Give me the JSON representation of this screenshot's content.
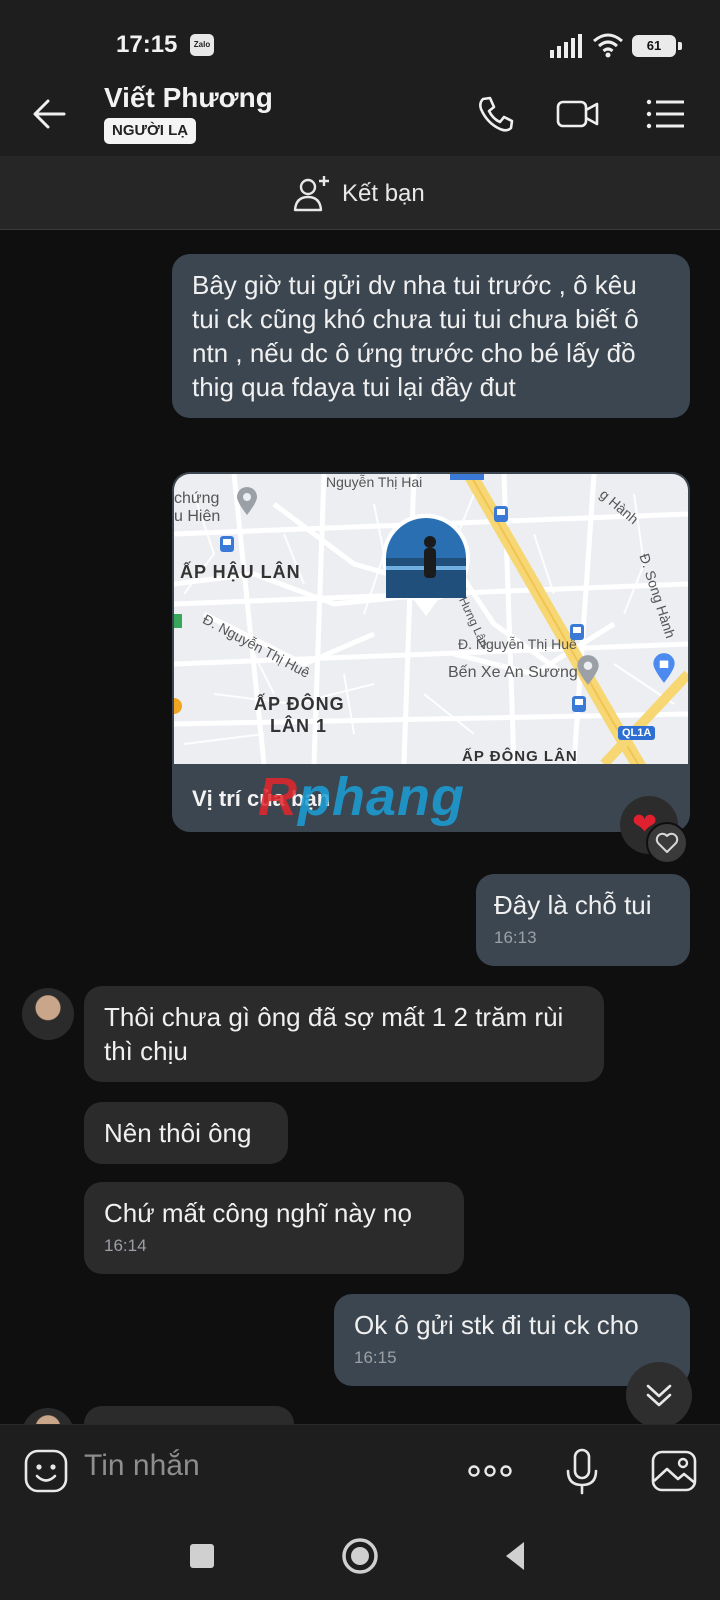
{
  "status": {
    "time": "17:15",
    "app_badge": "Zalo",
    "battery": "61"
  },
  "header": {
    "name": "Viết Phương",
    "tag": "NGƯỜI LẠ"
  },
  "add_friend": {
    "label": "Kết bạn"
  },
  "messages": {
    "m1": {
      "text": "Bây giờ tui gửi dv nha tui trước , ô kêu tui ck cũng khó chưa tui tui chưa biết ô ntn , nếu dc ô ứng trước cho bé lấy đồ thig qua fdaya tui lại đầy đut"
    },
    "location": {
      "caption": "Vị trí của bạn",
      "labels": {
        "nguyen_thi_hai": "Nguyễn Thị Hai",
        "chung_hien_1": "chứng",
        "chung_hien_2": "u Hiên",
        "ap_hau_lan": "ẤP HẬU LÂN",
        "nguyen_thi_hue": "Đ. Nguyễn Thị Huê",
        "nguyen_thi_hue2": "Đ. Nguyễn Thị Huê",
        "dong_lan": "Đông Lân - Hưng Lân",
        "song_hanh": "Đ. Song Hành",
        "hanh": "g Hành",
        "ben_xe": "Bến Xe An Sương",
        "ap_dong_lan": "ẤP ĐÔNG",
        "lan_1": "LÂN 1",
        "ap_dong_lan_bottom": "ẤP ĐÔNG LÂN",
        "ql1a": "QL1A"
      }
    },
    "watermark": {
      "part1": "R",
      "part2": "phang"
    },
    "m2": {
      "text": "Đây là chỗ tui",
      "time": "16:13"
    },
    "m3": {
      "text": "Thôi chưa gì ông đã sợ mất 1 2 trăm rùi thì chịu"
    },
    "m4": {
      "text": "Nên thôi ông"
    },
    "m5": {
      "text": "Chứ mất công nghĩ này nọ",
      "time": "16:14"
    },
    "m6": {
      "text": "Ok ô gửi stk đi tui ck cho",
      "time": "16:15"
    }
  },
  "composer": {
    "placeholder": "Tin nhắn"
  },
  "icons": [
    "back-arrow-icon",
    "phone-icon",
    "video-call-icon",
    "menu-list-icon",
    "add-user-icon",
    "heart-icon",
    "like-icon",
    "chevron-down-icon",
    "emoji-icon",
    "more-icon",
    "microphone-icon",
    "image-icon",
    "nav-recents-icon",
    "nav-home-icon",
    "nav-back-icon"
  ],
  "colors": {
    "outgoing_bubble": "#3c4650",
    "incoming_bubble": "#2b2b2b",
    "background": "#0f0f0f",
    "heart": "#e0202e"
  }
}
